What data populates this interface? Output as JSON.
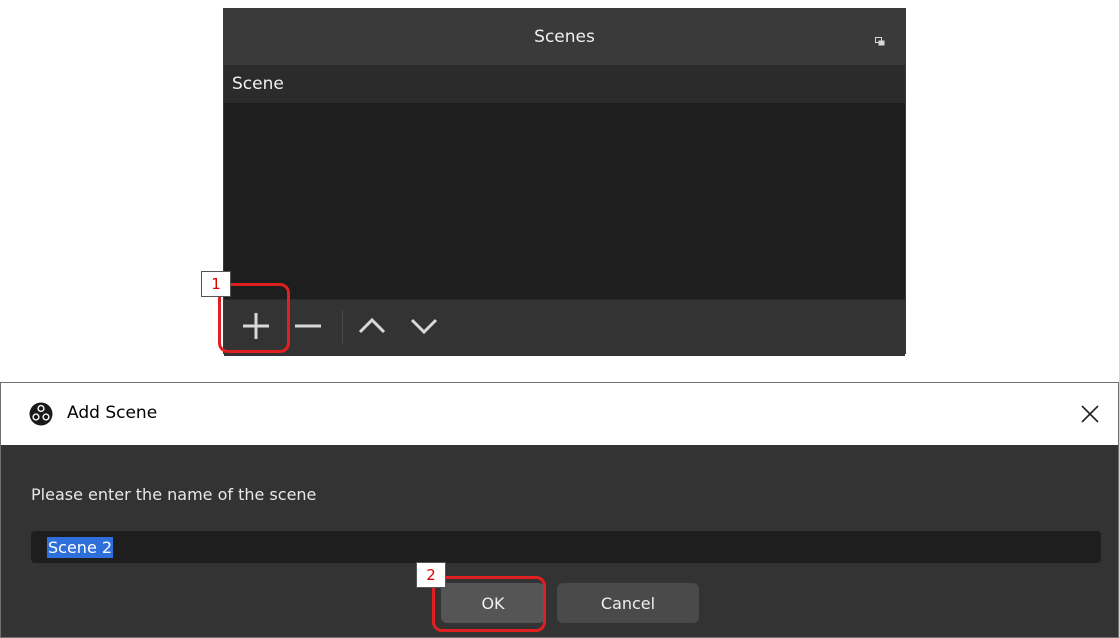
{
  "scenes_dock": {
    "title": "Scenes",
    "float_icon": "float-icon",
    "scenes": [
      {
        "name": "Scene",
        "selected": true
      }
    ],
    "toolbar": {
      "add_icon": "plus-icon",
      "remove_icon": "minus-icon",
      "move_up_icon": "chevron-up-icon",
      "move_down_icon": "chevron-down-icon"
    }
  },
  "dialog": {
    "title": "Add Scene",
    "logo_icon": "obs-logo-icon",
    "close_icon": "close-icon",
    "prompt": "Please enter the name of the scene",
    "input_value": "Scene 2",
    "ok_label": "OK",
    "cancel_label": "Cancel"
  },
  "annotations": {
    "step_1": "1",
    "step_2": "2",
    "highlight_color": "#e02020"
  },
  "colors": {
    "panel_bg": "#1e1e1e",
    "titlebar_bg": "#3a3a3a",
    "toolbar_bg": "#333333",
    "selection": "#2f6fdc"
  }
}
